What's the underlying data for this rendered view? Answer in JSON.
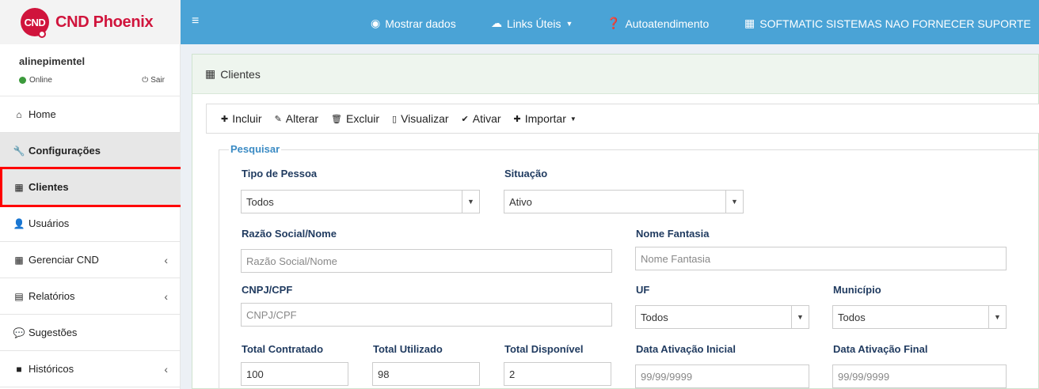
{
  "brand": {
    "badge": "CND",
    "name": "CND Phoenix",
    "color": "#d0143c"
  },
  "user": {
    "name": "alinepimentel",
    "status": "Online",
    "logout": "Sair"
  },
  "menu": {
    "items": [
      {
        "label": "Home",
        "icon": "home-icon"
      },
      {
        "label": "Configurações",
        "icon": "wrench-icon"
      },
      {
        "label": "Clientes",
        "icon": "building-icon"
      },
      {
        "label": "Usuários",
        "icon": "user-icon"
      },
      {
        "label": "Gerenciar CND",
        "icon": "calendar-icon"
      },
      {
        "label": "Relatórios",
        "icon": "document-icon"
      },
      {
        "label": "Sugestões",
        "icon": "comments-icon"
      },
      {
        "label": "Históricos",
        "icon": "archive-icon"
      }
    ]
  },
  "topbar": {
    "show_data": "Mostrar dados",
    "links": "Links Úteis",
    "self_service": "Autoatendimento",
    "company": "SOFTMATIC SISTEMAS NAO FORNECER SUPORTE"
  },
  "panel": {
    "title": "Clientes"
  },
  "toolbar": {
    "include": "Incluir",
    "edit": "Alterar",
    "delete": "Excluir",
    "view": "Visualizar",
    "activate": "Ativar",
    "import": "Importar"
  },
  "search": {
    "legend": "Pesquisar",
    "tipo_pessoa": {
      "label": "Tipo de Pessoa",
      "value": "Todos"
    },
    "situacao": {
      "label": "Situação",
      "value": "Ativo"
    },
    "razao": {
      "label": "Razão Social/Nome",
      "placeholder": "Razão Social/Nome"
    },
    "fantasia": {
      "label": "Nome Fantasia",
      "placeholder": "Nome Fantasia"
    },
    "cnpj": {
      "label": "CNPJ/CPF",
      "placeholder": "CNPJ/CPF"
    },
    "uf": {
      "label": "UF",
      "value": "Todos"
    },
    "municipio": {
      "label": "Município",
      "value": "Todos"
    },
    "total_contratado": {
      "label": "Total Contratado",
      "value": "100"
    },
    "total_utilizado": {
      "label": "Total Utilizado",
      "value": "98"
    },
    "total_disponivel": {
      "label": "Total Disponível",
      "value": "2"
    },
    "data_inicial": {
      "label": "Data Ativação Inicial",
      "placeholder": "99/99/9999"
    },
    "data_final": {
      "label": "Data Ativação Final",
      "placeholder": "99/99/9999"
    }
  },
  "colors": {
    "topbar": "#4aa3d6",
    "label": "#1f3a5f",
    "legend": "#3b8bc4",
    "highlight": "#ff0000"
  }
}
